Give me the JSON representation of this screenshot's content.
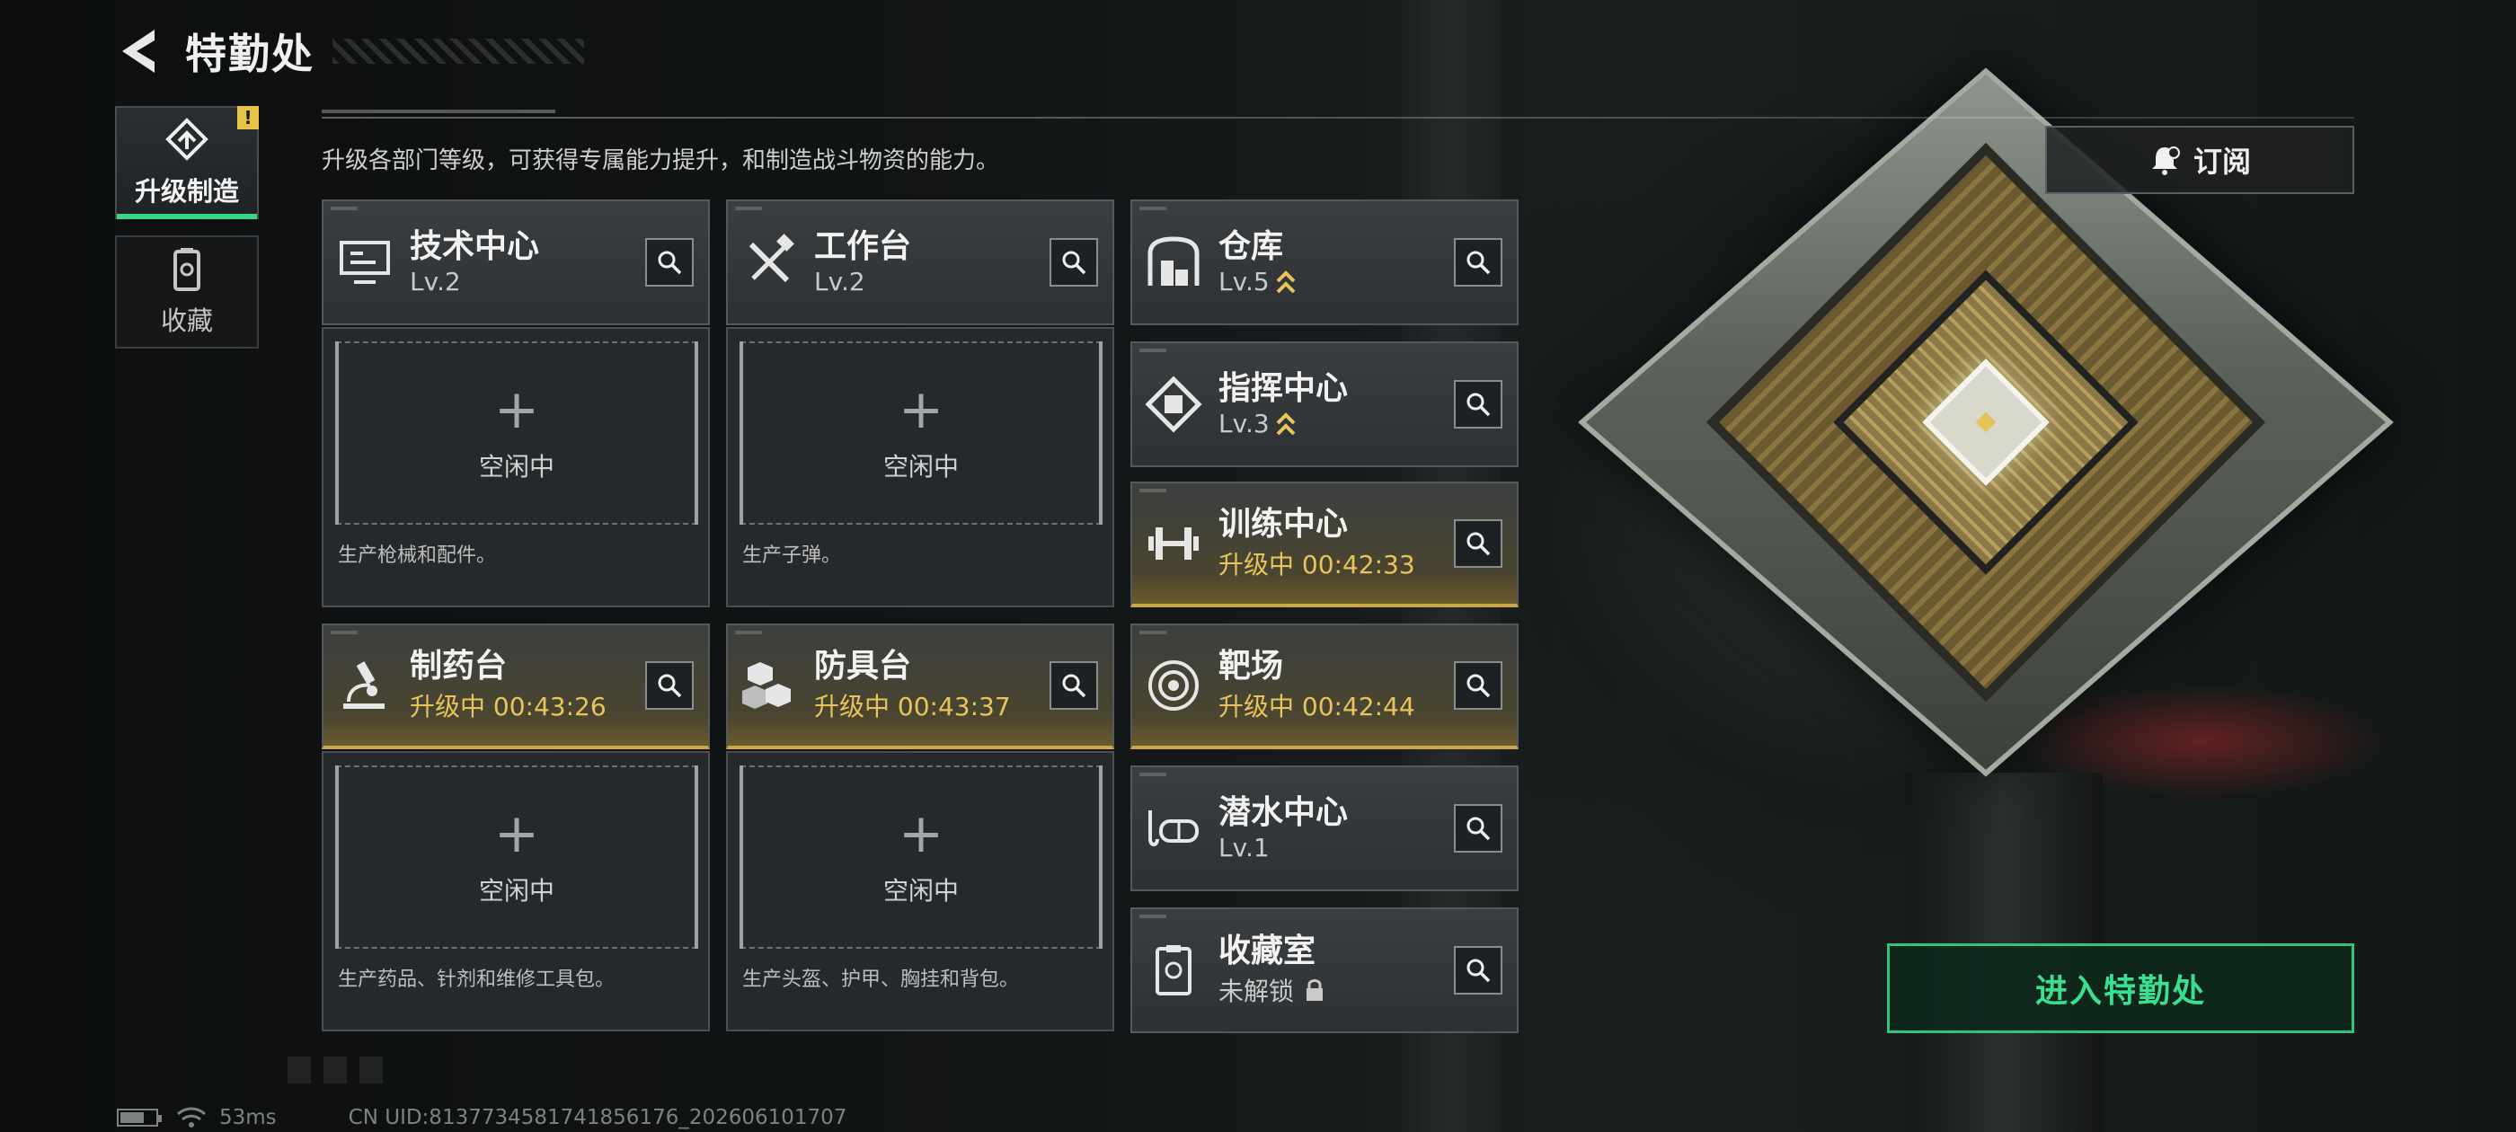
{
  "header": {
    "title": "特勤处"
  },
  "tabs": [
    {
      "label": "升级制造",
      "badge": "!"
    },
    {
      "label": "收藏"
    }
  ],
  "subtitle": "升级各部门等级，可获得专属能力提升，和制造战斗物资的能力。",
  "subscribe": {
    "label": "订阅"
  },
  "facilities": {
    "tech_center": {
      "name": "技术中心",
      "status": "Lv.2"
    },
    "workbench": {
      "name": "工作台",
      "status": "Lv.2"
    },
    "warehouse": {
      "name": "仓库",
      "status": "Lv.5"
    },
    "command_center": {
      "name": "指挥中心",
      "status": "Lv.3"
    },
    "training_center": {
      "name": "训练中心",
      "status": "升级中 00:42:33"
    },
    "pharmacy": {
      "name": "制药台",
      "status": "升级中 00:43:26"
    },
    "armor_bench": {
      "name": "防具台",
      "status": "升级中 00:43:37"
    },
    "shooting_range": {
      "name": "靶场",
      "status": "升级中 00:42:44"
    },
    "diving_center": {
      "name": "潜水中心",
      "status": "Lv.1"
    },
    "collection_room": {
      "name": "收藏室",
      "status": "未解锁"
    }
  },
  "slots": {
    "plus": "+",
    "idle": "空闲中",
    "tech_center_desc": "生产枪械和配件。",
    "workbench_desc": "生产子弹。",
    "pharmacy_desc": "生产药品、针剂和维修工具包。",
    "armor_bench_desc": "生产头盔、护甲、胸挂和背包。"
  },
  "enter": {
    "label": "进入特勤处"
  },
  "statusbar": {
    "ping": "53ms",
    "uid": "CN UID:8137734581741856176_202606101707"
  },
  "colors": {
    "accent_green": "#36d58a",
    "upgrade_gold": "#e9c45a",
    "panel": "#2d3133"
  },
  "icons": {
    "back": "back-arrow-icon",
    "upgrade_tab": "upgrade-icon",
    "collection_tab": "collection-icon",
    "subscribe": "bell-icon",
    "search": "search-icon",
    "level_up": "chevron-up-double-icon",
    "locked": "lock-icon"
  }
}
